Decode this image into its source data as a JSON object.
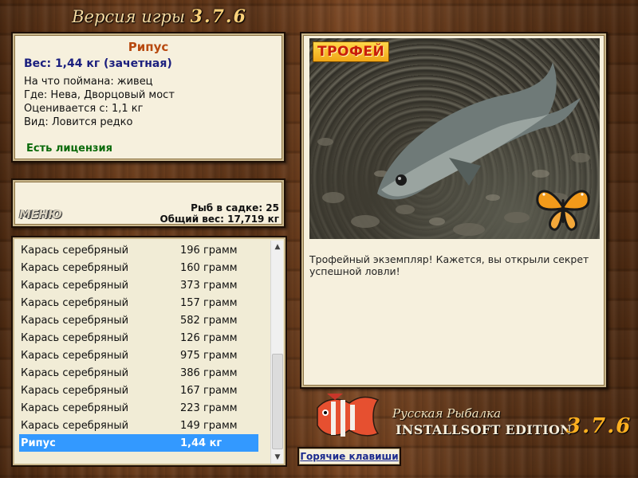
{
  "header": {
    "title_prefix": "Версия игры",
    "version": "3.7.6"
  },
  "fish": {
    "name": "Рипус",
    "weight_line": "Вес: 1,44 кг (зачетная)",
    "lines": [
      "На что поймана: живец",
      "Где: Нева, Дворцовый мост",
      "Оценивается с: 1,1 кг",
      "Вид: Ловится редко"
    ],
    "license": "Есть лицензия"
  },
  "stats": {
    "menu_label": "МЕНЮ",
    "count_line": "Рыб в садке: 25",
    "total_line": "Общий вес: 17,719 кг"
  },
  "catch_list": [
    {
      "name": "Карась серебряный",
      "weight": "196 грамм"
    },
    {
      "name": "Карась серебряный",
      "weight": "160 грамм"
    },
    {
      "name": "Карась серебряный",
      "weight": "373 грамм"
    },
    {
      "name": "Карась серебряный",
      "weight": "157 грамм"
    },
    {
      "name": "Карась серебряный",
      "weight": "582 грамм"
    },
    {
      "name": "Карась серебряный",
      "weight": "126 грамм"
    },
    {
      "name": "Карась серебряный",
      "weight": "975 грамм"
    },
    {
      "name": "Карась серебряный",
      "weight": "386 грамм"
    },
    {
      "name": "Карась серебряный",
      "weight": "167 грамм"
    },
    {
      "name": "Карась серебряный",
      "weight": "223 грамм"
    },
    {
      "name": "Карась серебряный",
      "weight": "149 грамм"
    },
    {
      "name": "Рипус",
      "weight": "1,44 кг",
      "selected": true
    }
  ],
  "trophy": {
    "badge": "ТРОФЕЙ",
    "text": "Трофейный экземпляр! Кажется, вы открыли секрет успешной ловли!"
  },
  "brand": {
    "line1": "Русская Рыбалка",
    "line2": "INSTALLSOFT EDITION",
    "version": "3.7.6"
  },
  "hotkeys_label": "Горячие клавиши",
  "colors": {
    "selection": "#3399ff",
    "fish_name": "#b84a10",
    "weight": "#1b1f7e",
    "license": "#0a6a0a"
  }
}
